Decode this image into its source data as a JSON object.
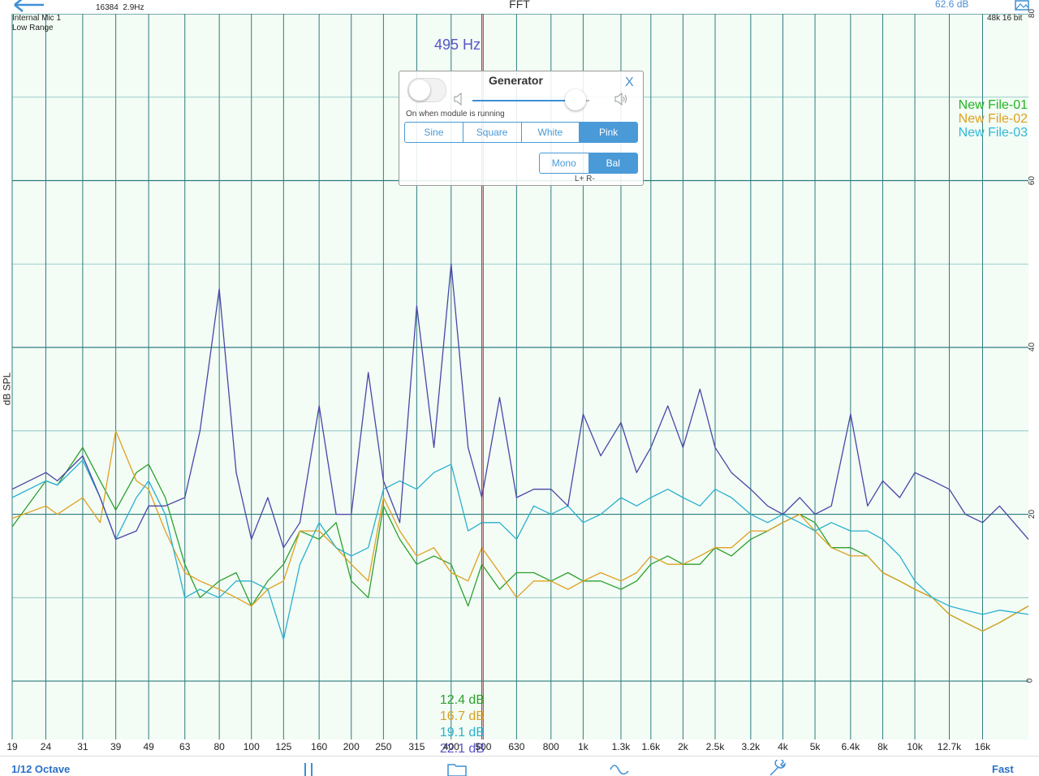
{
  "header": {
    "input_device": "Internal Mic 1",
    "input_range": "Low Range",
    "fft_size": "16384",
    "resolution": "2.9Hz",
    "title": "FFT",
    "level": "62.6 dB",
    "sample_format": "48k 16 bit",
    "back_icon": "back-arrow-icon",
    "settings_icon": "image-settings-icon"
  },
  "cursor": {
    "frequency_label": "495 Hz",
    "color": "#5a55c8",
    "readouts": [
      {
        "value": "12.4 dB",
        "color": "#2ea02e"
      },
      {
        "value": "16.7 dB",
        "color": "#d9a020"
      },
      {
        "value": "19.1 dB",
        "color": "#2ab0d0"
      },
      {
        "value": "22.1 dB",
        "color": "#5a55c8"
      }
    ]
  },
  "legend": [
    {
      "name": "New File-01",
      "color": "#22b422"
    },
    {
      "name": "New File-02",
      "color": "#e0a020"
    },
    {
      "name": "New File-03",
      "color": "#30b8d8"
    }
  ],
  "generator": {
    "title": "Generator",
    "close_label": "X",
    "toggle_on": false,
    "toggle_caption": "On when module is running",
    "volume_level": 0.88,
    "waveforms": [
      "Sine",
      "Square",
      "White",
      "Pink"
    ],
    "selected_waveform": "Pink",
    "channels": [
      "Mono",
      "Bal"
    ],
    "selected_channel": "Bal",
    "polarity_caption": "L+  R-"
  },
  "toolbar": {
    "octave_label": "1/12 Octave",
    "speed_label": "Fast",
    "icons": [
      "pause-icon",
      "folder-icon",
      "waveform-icon",
      "wrench-icon"
    ]
  },
  "chart_data": {
    "type": "line",
    "ylabel": "dB SPL",
    "ylim": [
      -7,
      80
    ],
    "y_ticks": [
      0,
      20,
      40,
      60,
      80
    ],
    "x_scale": "log",
    "xlim": [
      19,
      22000
    ],
    "x_tick_labels": [
      "19",
      "24",
      "31",
      "39",
      "49",
      "63",
      "80",
      "100",
      "125",
      "160",
      "200",
      "250",
      "315",
      "400",
      "500",
      "630",
      "800",
      "1k",
      "1.3k",
      "1.6k",
      "2k",
      "2.5k",
      "3.2k",
      "4k",
      "5k",
      "6.4k",
      "8k",
      "10k",
      "12.7k",
      "16k"
    ],
    "x_tick_values": [
      19,
      24,
      31,
      39,
      49,
      63,
      80,
      100,
      125,
      160,
      200,
      250,
      315,
      400,
      500,
      630,
      800,
      1000,
      1300,
      1600,
      2000,
      2500,
      3200,
      4000,
      5000,
      6400,
      8000,
      10000,
      12700,
      16000
    ],
    "grid": true,
    "cursor_frequency": 495,
    "series": [
      {
        "name": "New File-01",
        "color": "#2ea02e",
        "x": [
          19,
          24,
          26,
          31,
          35,
          39,
          45,
          49,
          55,
          63,
          70,
          80,
          90,
          100,
          112,
          125,
          140,
          160,
          180,
          200,
          225,
          250,
          280,
          315,
          355,
          400,
          450,
          495,
          560,
          630,
          710,
          800,
          900,
          1000,
          1130,
          1300,
          1450,
          1600,
          1800,
          2000,
          2250,
          2500,
          2800,
          3200,
          3600,
          4000,
          4500,
          5000,
          5600,
          6400,
          7200,
          8000,
          9000,
          10000,
          11300,
          12700,
          14200,
          16000,
          18000,
          22000
        ],
        "y": [
          18.5,
          24,
          23.5,
          28,
          24,
          20.5,
          25,
          26,
          22,
          14,
          10,
          12,
          13,
          9,
          12,
          14,
          18,
          17,
          19,
          12,
          10,
          21,
          17,
          14,
          15,
          14,
          9,
          14,
          11,
          13,
          13,
          12,
          13,
          12,
          12,
          11,
          12,
          14,
          15,
          14,
          14,
          16,
          15,
          17,
          18,
          19,
          20,
          19,
          16,
          16,
          15,
          13,
          12,
          11,
          10,
          8,
          7,
          6,
          7,
          9
        ]
      },
      {
        "name": "New File-02",
        "color": "#e0a020",
        "x": [
          19,
          24,
          26,
          31,
          35,
          39,
          45,
          49,
          55,
          63,
          70,
          80,
          90,
          100,
          112,
          125,
          140,
          160,
          180,
          200,
          225,
          250,
          280,
          315,
          355,
          400,
          450,
          495,
          560,
          630,
          710,
          800,
          900,
          1000,
          1130,
          1300,
          1450,
          1600,
          1800,
          2000,
          2250,
          2500,
          2800,
          3200,
          3600,
          4000,
          4500,
          5000,
          5600,
          6400,
          7200,
          8000,
          9000,
          10000,
          11300,
          12700,
          14200,
          16000,
          18000,
          22000
        ],
        "y": [
          19.5,
          21,
          20,
          22,
          19,
          30,
          24,
          23,
          18,
          13,
          12,
          11,
          10,
          9,
          11,
          12,
          18,
          18,
          16,
          14,
          12,
          22,
          18,
          15,
          16,
          13,
          12,
          16,
          13,
          10,
          12,
          12,
          11,
          12,
          13,
          12,
          13,
          15,
          14,
          14,
          15,
          16,
          16,
          18,
          18,
          19,
          20,
          18,
          16,
          15,
          15,
          13,
          12,
          11,
          10,
          8,
          7,
          6,
          7,
          9
        ]
      },
      {
        "name": "New File-03",
        "color": "#2ab0d0",
        "x": [
          19,
          24,
          26,
          31,
          35,
          39,
          45,
          49,
          55,
          63,
          70,
          80,
          90,
          100,
          112,
          125,
          140,
          160,
          180,
          200,
          225,
          250,
          280,
          315,
          355,
          400,
          450,
          495,
          560,
          630,
          710,
          800,
          900,
          1000,
          1130,
          1300,
          1450,
          1600,
          1800,
          2000,
          2250,
          2500,
          2800,
          3200,
          3600,
          4000,
          4500,
          5000,
          5600,
          6400,
          7200,
          8000,
          9000,
          10000,
          11300,
          12700,
          14200,
          16000,
          18000,
          22000
        ],
        "y": [
          22,
          24,
          23.5,
          26.5,
          22,
          17,
          22,
          24,
          20,
          10,
          11,
          10,
          12,
          12,
          11,
          5,
          14,
          19,
          16,
          15,
          16,
          23,
          24,
          23,
          25,
          26,
          18,
          19,
          19,
          17,
          21,
          20,
          21,
          19,
          20,
          22,
          21,
          22,
          23,
          22,
          21,
          23,
          22,
          20,
          19,
          20,
          19,
          18,
          19,
          18,
          18,
          17,
          15,
          12,
          10,
          9,
          8.5,
          8,
          8.5,
          8
        ]
      },
      {
        "name": "",
        "color": "#4a45a8",
        "x": [
          19,
          24,
          26,
          31,
          35,
          39,
          45,
          49,
          55,
          63,
          70,
          80,
          90,
          100,
          112,
          125,
          140,
          160,
          180,
          200,
          225,
          250,
          280,
          315,
          355,
          400,
          450,
          495,
          560,
          630,
          710,
          800,
          900,
          1000,
          1130,
          1300,
          1450,
          1600,
          1800,
          2000,
          2250,
          2500,
          2800,
          3200,
          3600,
          4000,
          4500,
          5000,
          5600,
          6400,
          7200,
          8000,
          9000,
          10000,
          11300,
          12700,
          14200,
          16000,
          18000,
          22000
        ],
        "y": [
          23,
          25,
          24,
          27,
          22,
          17,
          18,
          21,
          21,
          22,
          30,
          47,
          25,
          17,
          22,
          16,
          19,
          33,
          20,
          20,
          37,
          24,
          19,
          45,
          28,
          50,
          28,
          22,
          34,
          22,
          23,
          23,
          21,
          32,
          27,
          31,
          25,
          28,
          33,
          28,
          35,
          28,
          25,
          23,
          21,
          20,
          22,
          20,
          21,
          32,
          21,
          24,
          22,
          25,
          24,
          23,
          20,
          19,
          21,
          17
        ]
      }
    ]
  }
}
